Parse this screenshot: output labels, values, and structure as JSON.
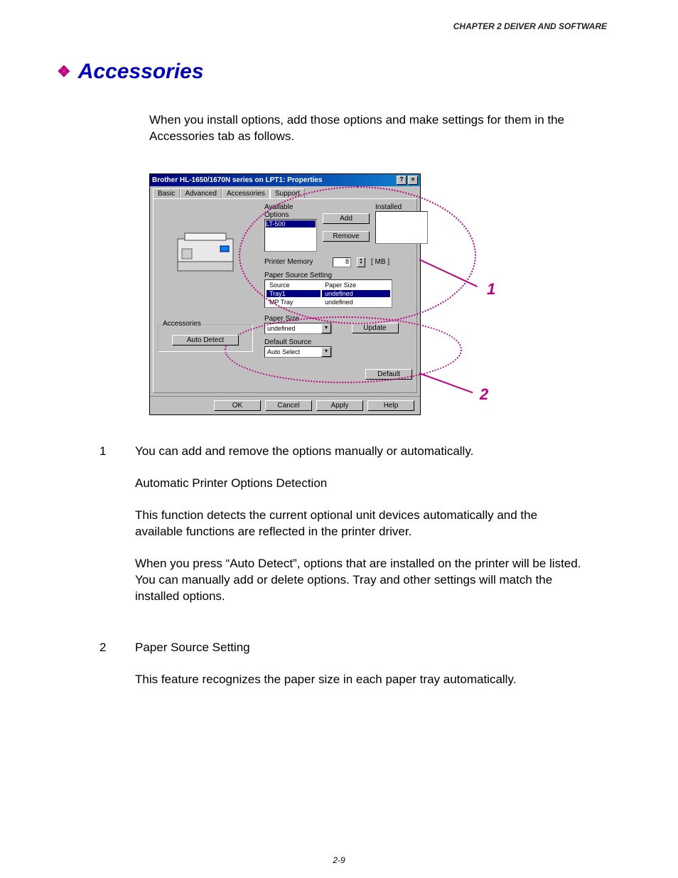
{
  "header": "CHAPTER 2 DEIVER AND SOFTWARE",
  "title": "Accessories",
  "intro": "When you install options, add those options and make settings for them in the Accessories tab as follows.",
  "dialog": {
    "title": "Brother HL-1650/1670N series on LPT1: Properties",
    "tabs": [
      "Basic",
      "Advanced",
      "Accessories",
      "Support"
    ],
    "active_tab": "Accessories",
    "available_label": "Available Options",
    "available_item": "LT-500",
    "installed_label": "Installed",
    "add_btn": "Add",
    "remove_btn": "Remove",
    "memory_label": "Printer Memory",
    "memory_value": "8",
    "memory_unit": "[ MB ]",
    "pss_label": "Paper Source Setting",
    "pss_col1": "Source",
    "pss_col2": "Paper Size",
    "pss_rows": [
      {
        "source": "Tray1",
        "size": "undefined"
      },
      {
        "source": "MP Tray",
        "size": "undefined"
      }
    ],
    "accessories_group": "Accessories",
    "auto_detect_btn": "Auto Detect",
    "paper_size_label": "Paper Size",
    "paper_size_value": "undefined",
    "update_btn": "Update",
    "default_source_label": "Default Source",
    "default_source_value": "Auto Select",
    "default_btn": "Default",
    "ok": "OK",
    "cancel": "Cancel",
    "apply": "Apply",
    "help": "Help"
  },
  "callouts": {
    "c1": "1",
    "c2": "2"
  },
  "items": {
    "n1": "1",
    "t1a": "You can add and remove the options manually or automatically.",
    "t1b": "Automatic Printer Options Detection",
    "t1c": "This function detects the current optional unit devices automatically and the available functions are reflected in the printer driver.",
    "t1d": "When you press “Auto Detect”, options that are installed on the printer will be listed. You can manually add or delete options. Tray and other settings will match the installed options.",
    "n2": "2",
    "t2a": "Paper Source Setting",
    "t2b": "This feature recognizes the paper size in each paper tray automatically."
  },
  "page_num": "2-9"
}
